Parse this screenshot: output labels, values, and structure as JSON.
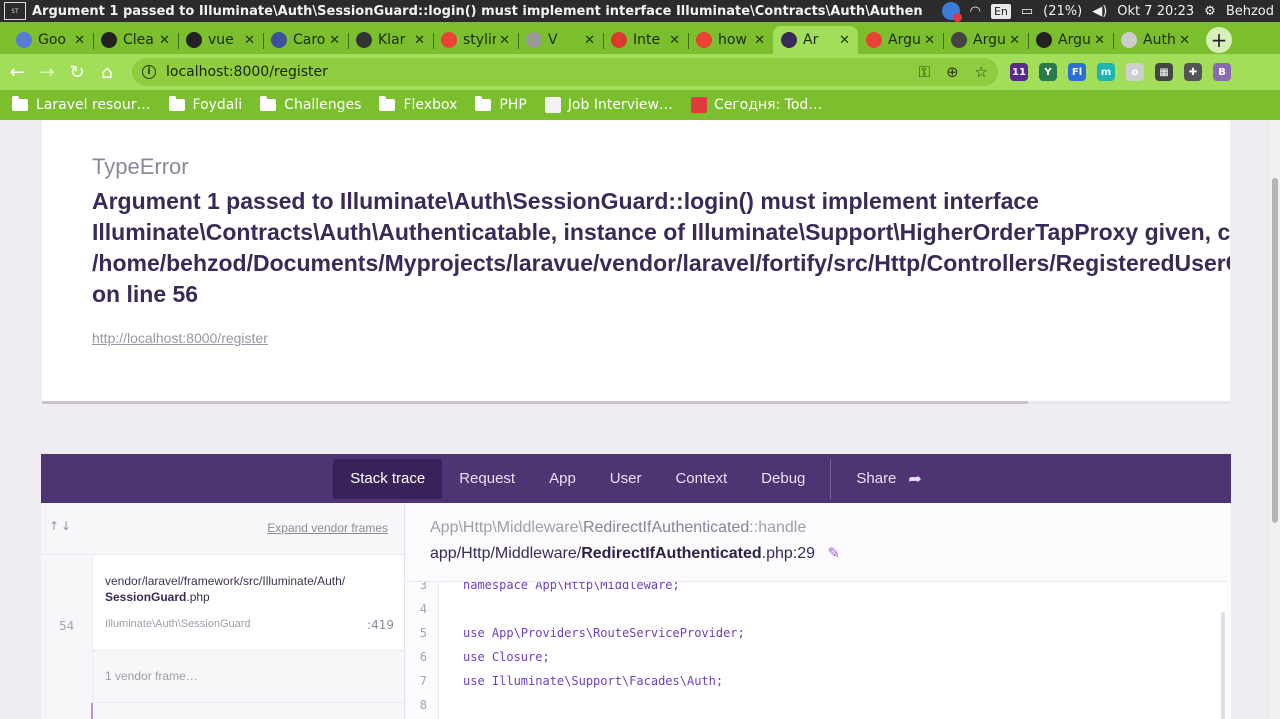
{
  "os": {
    "window_title": "Argument 1 passed to Illuminate\\Auth\\SessionGuard::login() must implement interface Illuminate\\Contracts\\Auth\\Authenticatabl",
    "lang": "En",
    "battery": "(21%)",
    "clock": "Okt  7 20:23",
    "user": "Behzod",
    "app_icon_text": "ST"
  },
  "browser": {
    "tabs": [
      {
        "label": "Goo",
        "color": "#5b7bd8"
      },
      {
        "label": "Clea",
        "color": "#222222"
      },
      {
        "label": "vue",
        "color": "#222222"
      },
      {
        "label": "Caro",
        "color": "#3f4f9c"
      },
      {
        "label": "Klar",
        "color": "#333333"
      },
      {
        "label": "stylin",
        "color": "#ea4335"
      },
      {
        "label": "V",
        "color": "#999999"
      },
      {
        "label": "Inte",
        "color": "#d83a2c"
      },
      {
        "label": "how",
        "color": "#ea4335"
      },
      {
        "label": "Ar",
        "color": "#3a2a58",
        "active": true
      },
      {
        "label": "Argu",
        "color": "#ea4335"
      },
      {
        "label": "Argu",
        "color": "#444444"
      },
      {
        "label": "Argu",
        "color": "#222222"
      },
      {
        "label": "Auth",
        "color": "#cccccc"
      }
    ],
    "new_tab": "+",
    "url": "localhost:8000/register",
    "extensions": [
      {
        "label": "11",
        "color": "#5a2a8a"
      },
      {
        "label": "Y",
        "color": "#2a7a4a"
      },
      {
        "label": "Fl",
        "color": "#2b6fd6"
      },
      {
        "label": "m",
        "color": "#1fb5b5"
      },
      {
        "label": "o",
        "color": "#cfcfcf"
      },
      {
        "label": "▦",
        "color": "#444444"
      },
      {
        "label": "✚",
        "color": "#555555"
      },
      {
        "label": "B",
        "color": "#8a6bb0"
      }
    ],
    "bookmarks": [
      {
        "label": "Laravel resour…",
        "kind": "folder"
      },
      {
        "label": "Foydali",
        "kind": "folder"
      },
      {
        "label": "Challenges",
        "kind": "folder"
      },
      {
        "label": "Flexbox",
        "kind": "folder"
      },
      {
        "label": "PHP",
        "kind": "folder"
      },
      {
        "label": "Job Interview…",
        "kind": "site",
        "color": "#f2f2f2"
      },
      {
        "label": "Сегодня: Tod…",
        "kind": "site",
        "color": "#e0393e"
      }
    ]
  },
  "error": {
    "type": "TypeError",
    "message_lines": [
      "Argument 1 passed to Illuminate\\Auth\\SessionGuard::login() must implement interface",
      "Illuminate\\Contracts\\Auth\\Authenticatable, instance of Illuminate\\Support\\HigherOrderTapProxy given, called in",
      "/home/behzod/Documents/Myprojects/laravue/vendor/laravel/fortify/src/Http/Controllers/RegisteredUserController.php",
      "on line 56"
    ],
    "url": "http://localhost:8000/register",
    "progress": 0.83
  },
  "panel": {
    "tabs": [
      "Stack trace",
      "Request",
      "App",
      "User",
      "Context",
      "Debug"
    ],
    "active_tab": "Stack trace",
    "share": "Share",
    "expand_vendor": "Expand vendor frames",
    "frame": {
      "number": "54",
      "path": "vendor/laravel/framework/src/Illuminate/Auth/",
      "file_bold": "SessionGuard",
      "file_ext": ".php",
      "class": "Illuminate\\Auth\\SessionGuard",
      "line": ":419"
    },
    "vendor_frames": "1 vendor frame…",
    "code": {
      "fn_prefix": "App\\Http\\Middleware\\",
      "fn_name": "RedirectIfAuthenticated",
      "fn_method": "::handle",
      "file_dir": "app/Http/Middleware/",
      "file_bold": "RedirectIfAuthenticated",
      "file_rest": ".php:29",
      "lines": [
        {
          "n": "3",
          "text": "namespace App\\Http\\Middleware;"
        },
        {
          "n": "4",
          "text": ""
        },
        {
          "n": "5",
          "text": "use App\\Providers\\RouteServiceProvider;"
        },
        {
          "n": "6",
          "text": "use Closure;"
        },
        {
          "n": "7",
          "text": "use Illuminate\\Support\\Facades\\Auth;"
        },
        {
          "n": "8",
          "text": ""
        }
      ]
    }
  }
}
